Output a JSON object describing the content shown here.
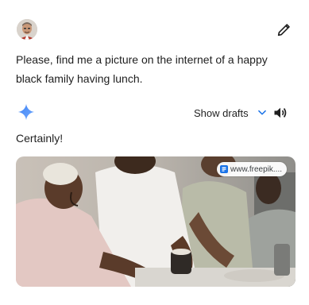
{
  "user": {
    "prompt": "Please, find me a picture on the internet of a happy black family having lunch."
  },
  "response": {
    "show_drafts_label": "Show drafts",
    "reply_text": "Certainly!",
    "image_source": "www.freepik...."
  },
  "icons": {
    "edit": "pencil-icon",
    "assistant": "gemini-sparkle-icon",
    "drafts_toggle": "chevron-down-icon",
    "read_aloud": "speaker-icon",
    "source_favicon": "freepik-favicon-icon"
  },
  "colors": {
    "accent_blue": "#1a73e8",
    "sparkle_blue": "#4285f4",
    "text": "#1f1f1f"
  }
}
